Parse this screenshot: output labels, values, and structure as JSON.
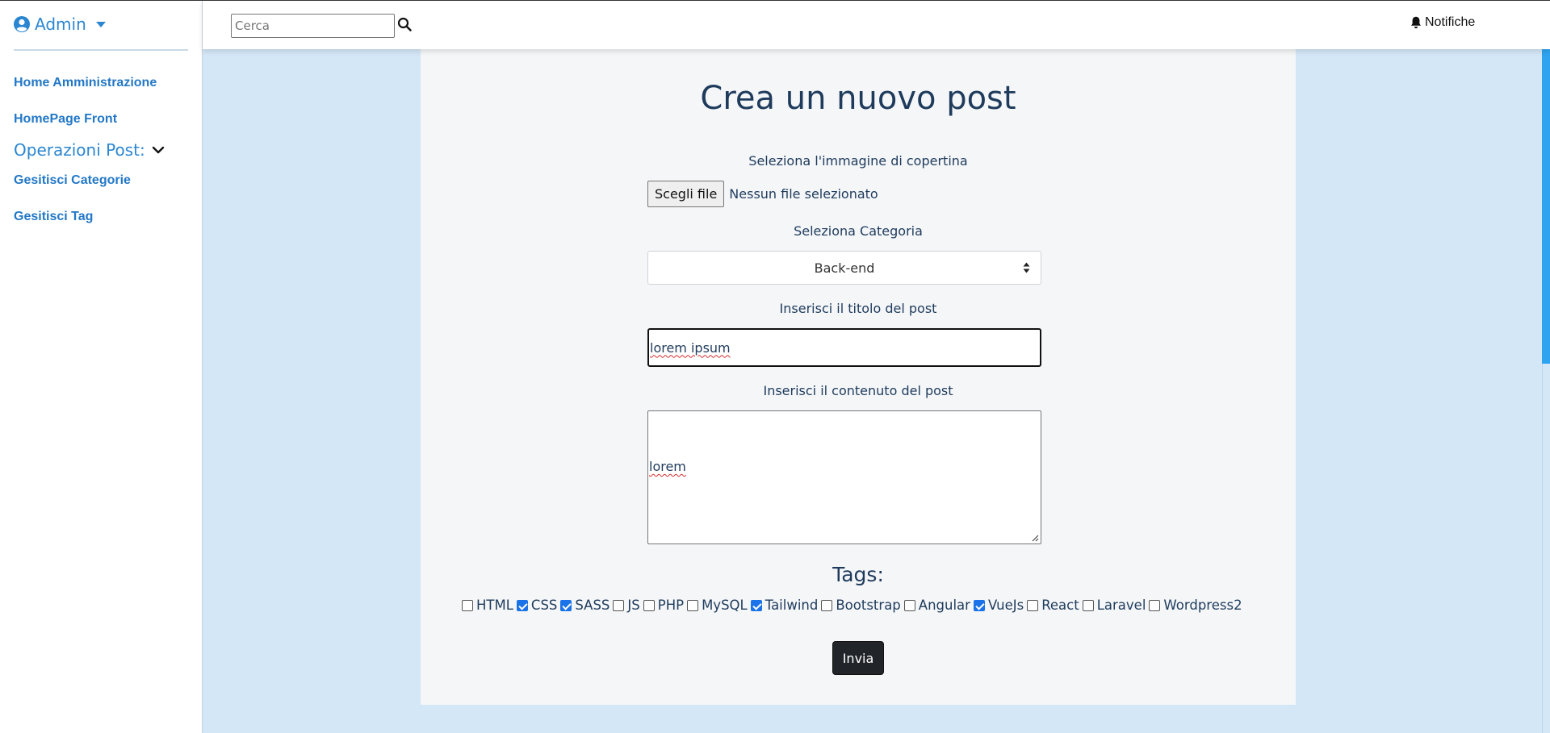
{
  "sidebar": {
    "user_label": "Admin",
    "links": [
      {
        "label": "Home Amministrazione"
      },
      {
        "label": "HomePage Front"
      },
      {
        "label": "Gesitisci Categorie"
      },
      {
        "label": "Gesitisci Tag"
      }
    ],
    "section_label": "Operazioni Post:"
  },
  "topbar": {
    "search_placeholder": "Cerca",
    "notifications_label": "Notifiche"
  },
  "form": {
    "title": "Crea un nuovo post",
    "cover_label": "Seleziona l'immagine di copertina",
    "file_button_label": "Scegli file",
    "file_status": "Nessun file selezionato",
    "category_label": "Seleziona Categoria",
    "category_value": "Back-end",
    "post_title_label": "Inserisci il titolo del post",
    "post_title_value": "lorem ipsum",
    "content_label": "Inserisci il contenuto del post",
    "content_value": "lorem",
    "tags_title": "Tags:",
    "tags": [
      {
        "label": "HTML",
        "checked": false
      },
      {
        "label": "CSS",
        "checked": true
      },
      {
        "label": "SASS",
        "checked": true
      },
      {
        "label": "JS",
        "checked": false
      },
      {
        "label": "PHP",
        "checked": false
      },
      {
        "label": "MySQL",
        "checked": false
      },
      {
        "label": "Tailwind",
        "checked": true
      },
      {
        "label": "Bootstrap",
        "checked": false
      },
      {
        "label": "Angular",
        "checked": false
      },
      {
        "label": "VueJs",
        "checked": true
      },
      {
        "label": "React",
        "checked": false
      },
      {
        "label": "Laravel",
        "checked": false
      },
      {
        "label": "Wordpress2",
        "checked": false
      }
    ],
    "submit_label": "Invia"
  },
  "colors": {
    "accent": "#2b86d1",
    "page_bg": "#d4e7f7",
    "card_bg": "#f4f6f8",
    "submit_bg": "#212529",
    "checkbox_checked": "#1a73e8"
  }
}
